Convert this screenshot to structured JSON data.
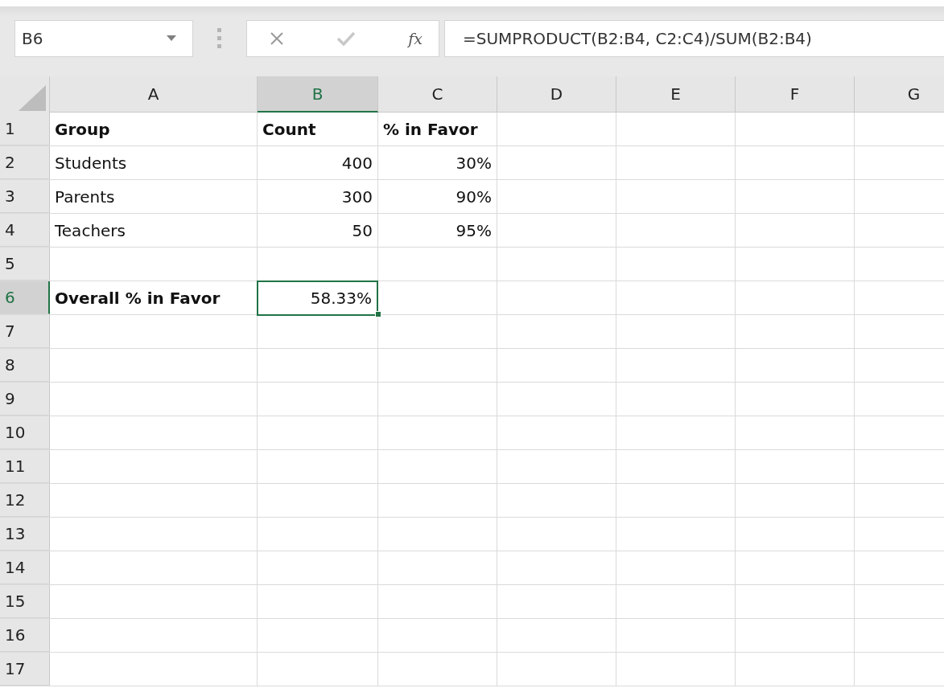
{
  "name_box": {
    "value": "B6"
  },
  "formula_bar": {
    "fx": "fx",
    "value": "=SUMPRODUCT(B2:B4, C2:C4)/SUM(B2:B4)"
  },
  "columns": [
    {
      "label": "A",
      "selected": false
    },
    {
      "label": "B",
      "selected": true
    },
    {
      "label": "C",
      "selected": false
    },
    {
      "label": "D",
      "selected": false
    },
    {
      "label": "E",
      "selected": false
    },
    {
      "label": "F",
      "selected": false
    },
    {
      "label": "G",
      "selected": false
    }
  ],
  "rows": [
    {
      "label": "1",
      "selected": false,
      "cells": [
        {
          "text": "Group",
          "kind": "text",
          "bold": true,
          "selected": false
        },
        {
          "text": "Count",
          "kind": "text",
          "bold": true,
          "selected": false
        },
        {
          "text": "% in Favor",
          "kind": "text",
          "bold": true,
          "selected": false
        }
      ]
    },
    {
      "label": "2",
      "selected": false,
      "cells": [
        {
          "text": "Students",
          "kind": "text",
          "bold": false,
          "selected": false
        },
        {
          "text": "400",
          "kind": "number",
          "bold": false,
          "selected": false
        },
        {
          "text": "30%",
          "kind": "number",
          "bold": false,
          "selected": false
        }
      ]
    },
    {
      "label": "3",
      "selected": false,
      "cells": [
        {
          "text": "Parents",
          "kind": "text",
          "bold": false,
          "selected": false
        },
        {
          "text": "300",
          "kind": "number",
          "bold": false,
          "selected": false
        },
        {
          "text": "90%",
          "kind": "number",
          "bold": false,
          "selected": false
        }
      ]
    },
    {
      "label": "4",
      "selected": false,
      "cells": [
        {
          "text": "Teachers",
          "kind": "text",
          "bold": false,
          "selected": false
        },
        {
          "text": "50",
          "kind": "number",
          "bold": false,
          "selected": false
        },
        {
          "text": "95%",
          "kind": "number",
          "bold": false,
          "selected": false
        }
      ]
    },
    {
      "label": "5",
      "selected": false
    },
    {
      "label": "6",
      "selected": true,
      "cells": [
        {
          "text": "Overall % in Favor",
          "kind": "text",
          "bold": true,
          "selected": false
        },
        {
          "text": "58.33%",
          "kind": "number",
          "bold": false,
          "selected": true
        }
      ]
    },
    {
      "label": "7",
      "selected": false
    },
    {
      "label": "8",
      "selected": false
    },
    {
      "label": "9",
      "selected": false
    },
    {
      "label": "10",
      "selected": false
    },
    {
      "label": "11",
      "selected": false
    },
    {
      "label": "12",
      "selected": false
    },
    {
      "label": "13",
      "selected": false
    },
    {
      "label": "14",
      "selected": false
    },
    {
      "label": "15",
      "selected": false
    },
    {
      "label": "16",
      "selected": false
    },
    {
      "label": "17",
      "selected": false
    }
  ]
}
